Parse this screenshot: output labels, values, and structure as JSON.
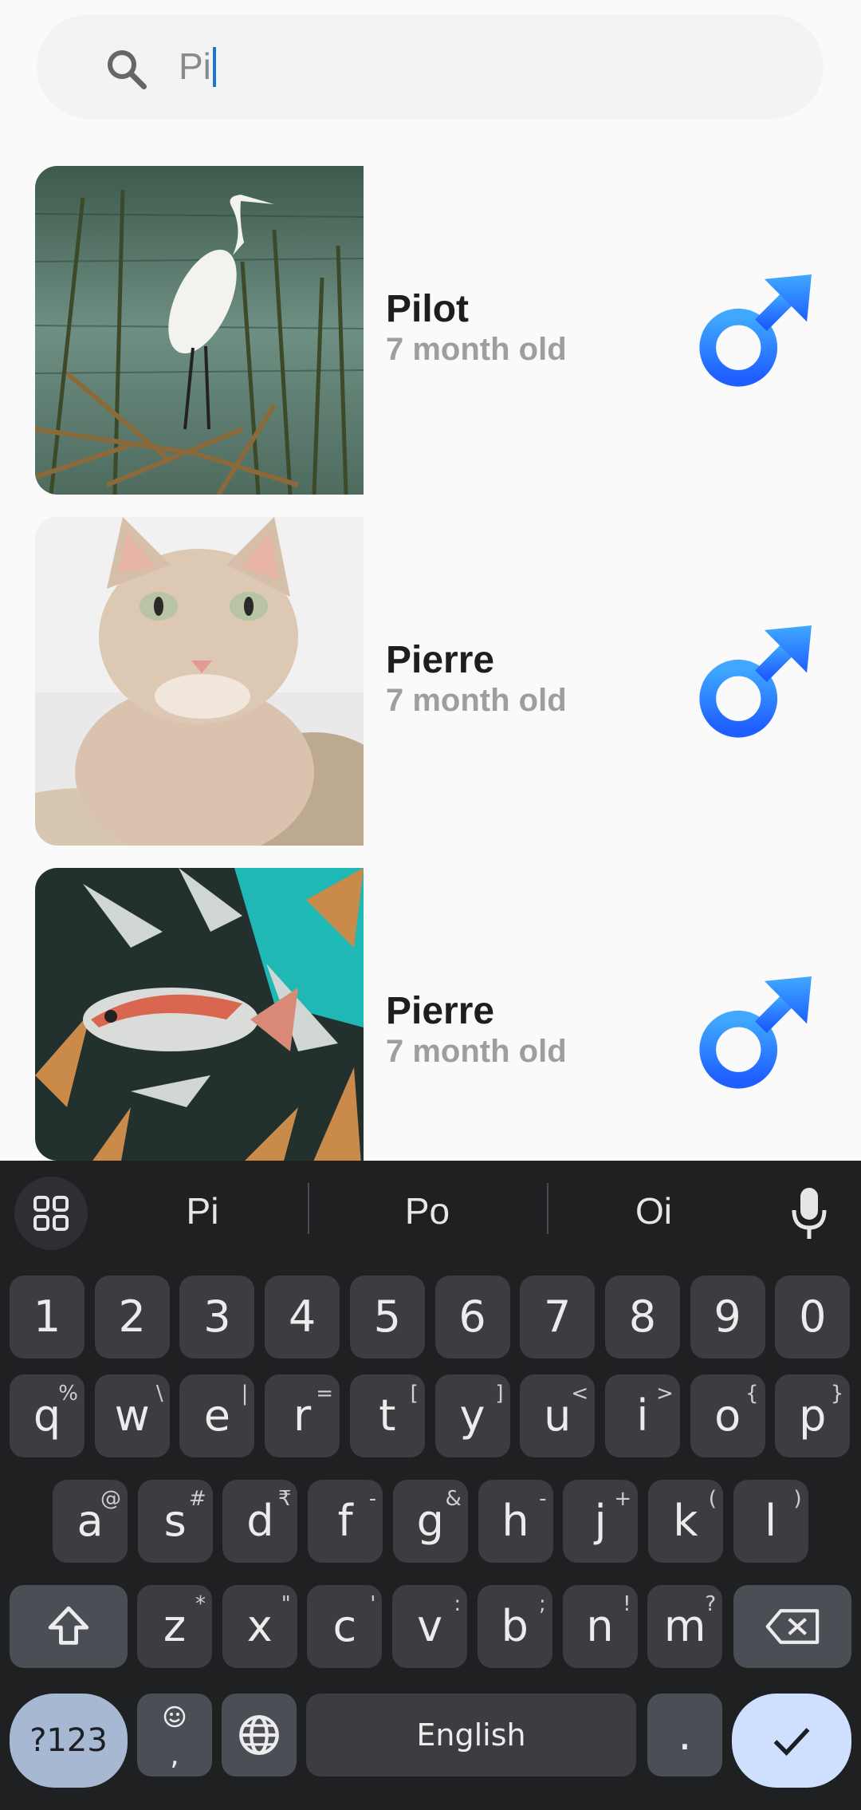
{
  "search": {
    "value": "Pi",
    "icon": "search-icon"
  },
  "pets": [
    {
      "name": "Pilot",
      "age": "7 month old",
      "gender_icon": "male-icon",
      "image": "heron"
    },
    {
      "name": "Pierre",
      "age": "7 month old",
      "gender_icon": "male-icon",
      "image": "cat"
    },
    {
      "name": "Pierre",
      "age": "7 month old",
      "gender_icon": "male-icon",
      "image": "fish"
    }
  ],
  "colors": {
    "gender_blue_top": "#40a9ff",
    "gender_blue_bottom": "#1e5eff",
    "keyboard_bg": "#1f2022"
  },
  "keyboard": {
    "suggestions": [
      "Pi",
      "Po",
      "Oi"
    ],
    "numbers": [
      "1",
      "2",
      "3",
      "4",
      "5",
      "6",
      "7",
      "8",
      "9",
      "0"
    ],
    "row1": [
      {
        "k": "q",
        "s": "%"
      },
      {
        "k": "w",
        "s": "\\"
      },
      {
        "k": "e",
        "s": "|"
      },
      {
        "k": "r",
        "s": "="
      },
      {
        "k": "t",
        "s": "["
      },
      {
        "k": "y",
        "s": "]"
      },
      {
        "k": "u",
        "s": "<"
      },
      {
        "k": "i",
        "s": ">"
      },
      {
        "k": "o",
        "s": "{"
      },
      {
        "k": "p",
        "s": "}"
      }
    ],
    "row2": [
      {
        "k": "a",
        "s": "@"
      },
      {
        "k": "s",
        "s": "#"
      },
      {
        "k": "d",
        "s": "₹"
      },
      {
        "k": "f",
        "s": "-"
      },
      {
        "k": "g",
        "s": "&"
      },
      {
        "k": "h",
        "s": "-"
      },
      {
        "k": "j",
        "s": "+"
      },
      {
        "k": "k",
        "s": "("
      },
      {
        "k": "l",
        "s": ")"
      }
    ],
    "row3": [
      {
        "k": "z",
        "s": "*"
      },
      {
        "k": "x",
        "s": "\""
      },
      {
        "k": "c",
        "s": "'"
      },
      {
        "k": "v",
        "s": ":"
      },
      {
        "k": "b",
        "s": ";"
      },
      {
        "k": "n",
        "s": "!"
      },
      {
        "k": "m",
        "s": "?"
      }
    ],
    "symbols_label": "?123",
    "comma_label": ",",
    "space_label": "English",
    "period_label": "."
  }
}
